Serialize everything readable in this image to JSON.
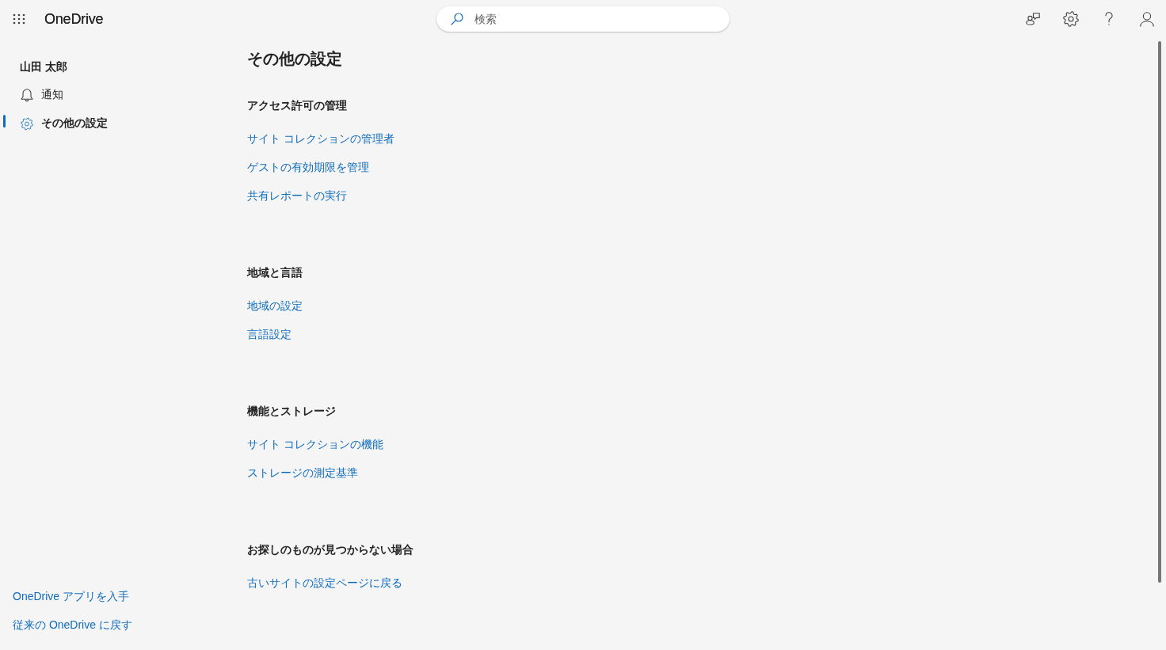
{
  "header": {
    "app_name": "OneDrive",
    "search": {
      "placeholder": "検索"
    }
  },
  "sidebar": {
    "user_name": "山田 太郎",
    "items": [
      {
        "label": "通知",
        "selected": false
      },
      {
        "label": "その他の設定",
        "selected": true
      }
    ],
    "footer_links": [
      "OneDrive アプリを入手",
      "従来の OneDrive に戻す"
    ]
  },
  "main": {
    "title": "その他の設定",
    "sections": [
      {
        "heading": "アクセス許可の管理",
        "links": [
          "サイト コレクションの管理者",
          "ゲストの有効期限を管理",
          "共有レポートの実行"
        ]
      },
      {
        "heading": "地域と言語",
        "links": [
          "地域の設定",
          "言語設定"
        ]
      },
      {
        "heading": "機能とストレージ",
        "links": [
          "サイト コレクションの機能",
          "ストレージの測定基準"
        ]
      },
      {
        "heading": "お探しのものが見つからない場合",
        "links": [
          "古いサイトの設定ページに戻る"
        ]
      }
    ]
  }
}
